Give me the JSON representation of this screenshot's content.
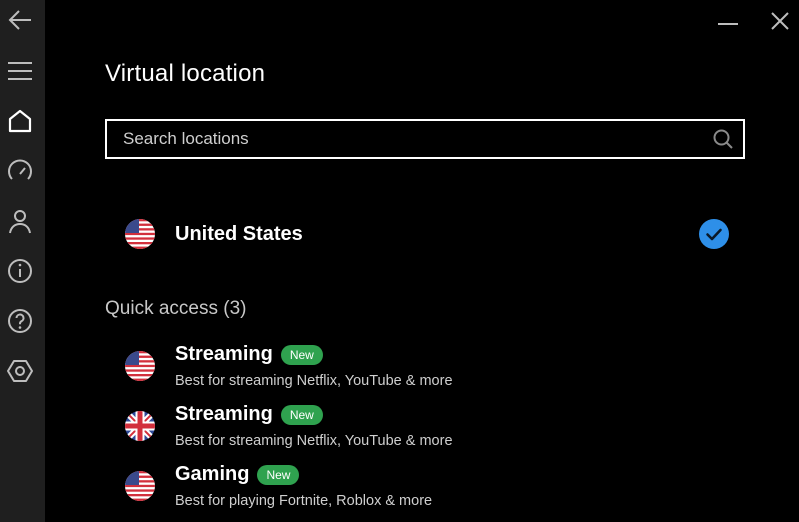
{
  "sidebar": {
    "items": [
      {
        "name": "back-arrow-icon"
      },
      {
        "name": "menu-icon"
      },
      {
        "name": "home-icon"
      },
      {
        "name": "speed-icon"
      },
      {
        "name": "account-icon"
      },
      {
        "name": "info-icon"
      },
      {
        "name": "help-icon"
      },
      {
        "name": "settings-icon"
      }
    ]
  },
  "window": {
    "minimize_icon": "minimize-icon",
    "close_icon": "close-icon"
  },
  "page": {
    "title": "Virtual location"
  },
  "search": {
    "placeholder": "Search locations",
    "value": ""
  },
  "selected_location": {
    "name": "United States",
    "flag": "us",
    "checked": true
  },
  "quick_access": {
    "heading": "Quick access (3)",
    "items": [
      {
        "title": "Streaming",
        "badge": "New",
        "description": "Best for streaming Netflix, YouTube & more",
        "flag": "us"
      },
      {
        "title": "Streaming",
        "badge": "New",
        "description": "Best for streaming Netflix, YouTube & more",
        "flag": "uk"
      },
      {
        "title": "Gaming",
        "badge": "New",
        "description": "Best for playing Fortnite, Roblox & more",
        "flag": "us"
      }
    ]
  },
  "colors": {
    "background": "#000000",
    "sidebar": "#1f1f1f",
    "accent": "#2e8fe8",
    "badge": "#2fa24f"
  }
}
